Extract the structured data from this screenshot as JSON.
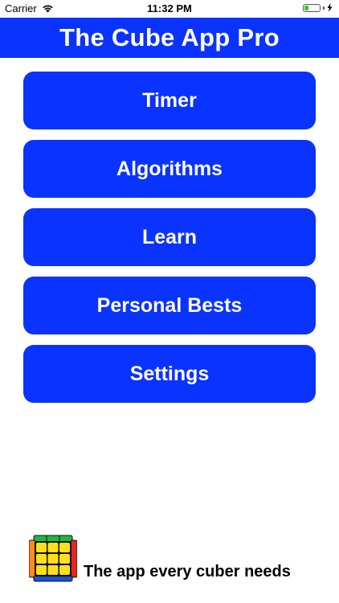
{
  "status_bar": {
    "carrier": "Carrier",
    "time": "11:32 PM",
    "battery_level": 0.25,
    "icons": [
      "wifi-icon",
      "battery-icon",
      "charging-bolt-icon"
    ]
  },
  "header": {
    "title": "The Cube App Pro"
  },
  "menu": {
    "items": [
      {
        "label": "Timer"
      },
      {
        "label": "Algorithms"
      },
      {
        "label": "Learn"
      },
      {
        "label": "Personal Bests"
      },
      {
        "label": "Settings"
      }
    ]
  },
  "footer": {
    "logo_icon": "rubiks-cube-icon",
    "tagline": "The app every cuber needs"
  },
  "colors": {
    "primary": "#0a33ff",
    "background": "#ffffff",
    "text_on_primary": "#ffffff",
    "cube_yellow": "#ffe01a",
    "cube_green": "#1fb83a",
    "cube_red": "#e8261c",
    "cube_orange": "#ff8c1a",
    "cube_blue": "#1a4fd6"
  }
}
